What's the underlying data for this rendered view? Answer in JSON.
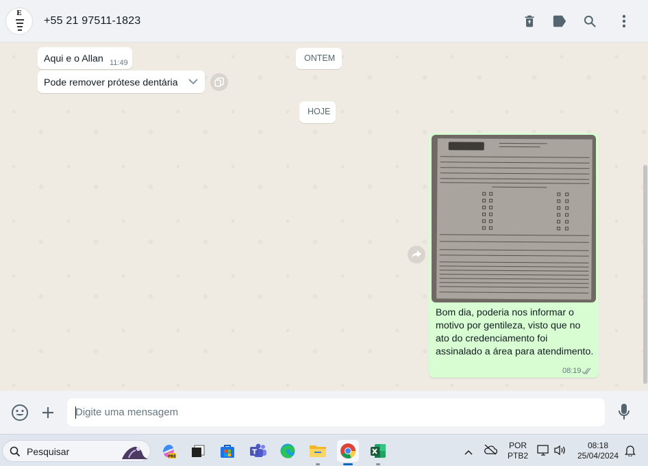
{
  "header": {
    "avatar_letter": "E",
    "contact_name": "+55 21 97511-1823",
    "icons": [
      "trash-icon",
      "label-icon",
      "search-icon",
      "menu-icon"
    ]
  },
  "chat": {
    "messages_in": [
      {
        "text": "Aqui e o Allan",
        "time": "11:49"
      },
      {
        "text": "Pode remover prótese dentária"
      }
    ],
    "date_chips": {
      "yesterday": "ONTEM",
      "today": "HOJE"
    },
    "message_out": {
      "text": "Bom dia, poderia nos informar o motivo por gentileza, visto que no ato do credenciamento foi assinalado a área para atendimento.",
      "time": "08:19",
      "status": "read"
    }
  },
  "composer": {
    "placeholder": "Digite uma mensagem"
  },
  "taskbar": {
    "search_label": "Pesquisar",
    "language": "POR",
    "keyboard": "PTB2",
    "time": "08:18",
    "date": "25/04/2024"
  },
  "colors": {
    "chat_bg": "#efeae2",
    "bubble_out": "#d9fdd3",
    "bubble_in": "#ffffff",
    "icon": "#54656f"
  }
}
